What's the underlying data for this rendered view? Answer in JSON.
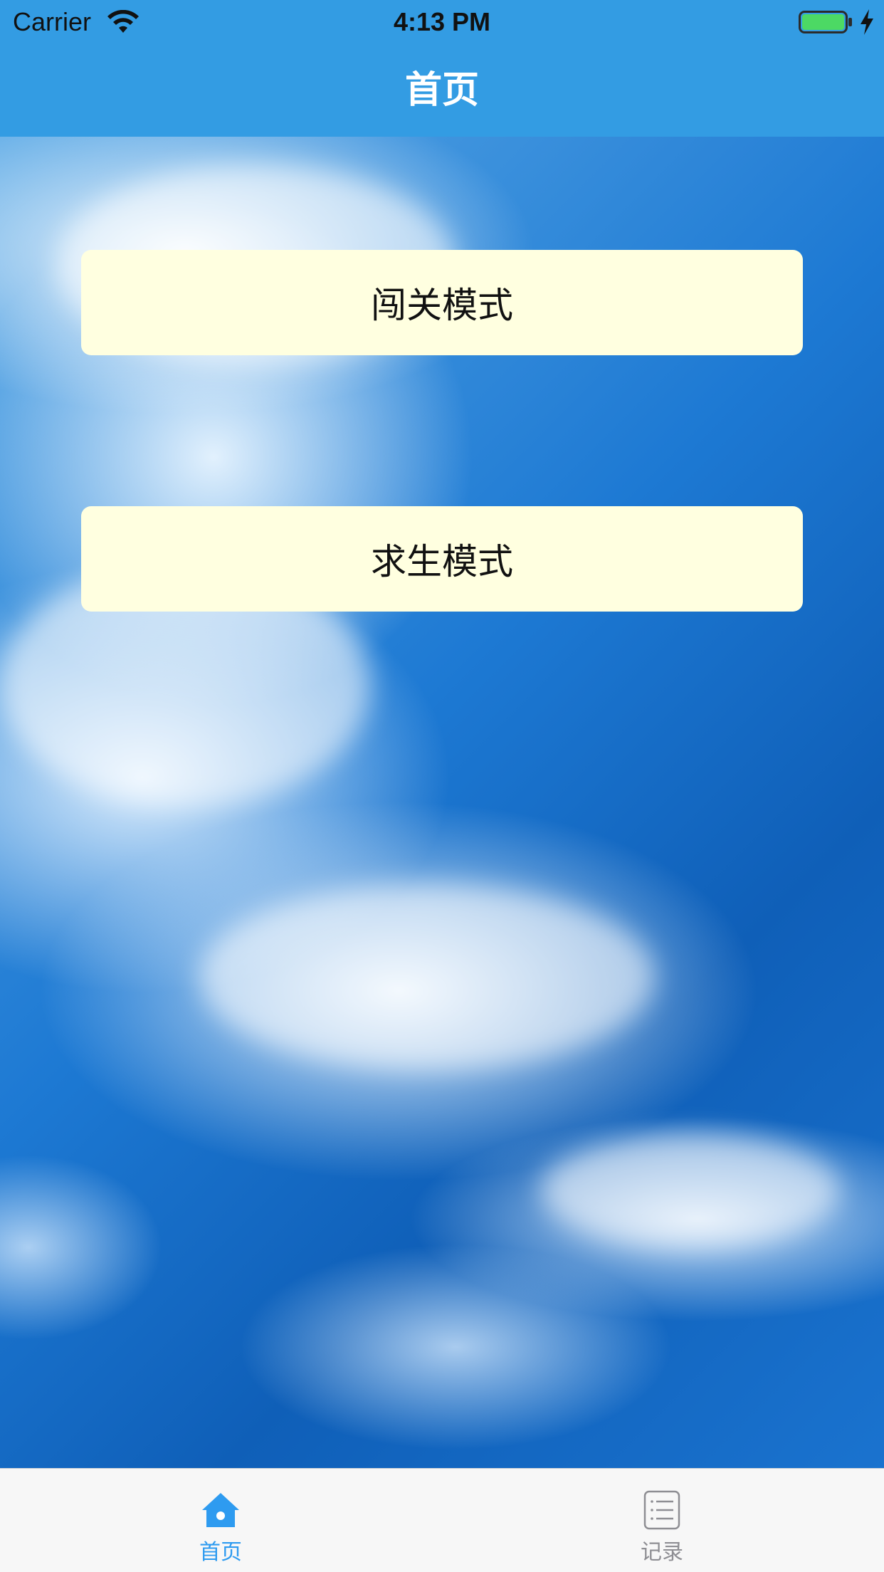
{
  "status_bar": {
    "carrier": "Carrier",
    "time": "4:13 PM",
    "wifi_icon": "wifi-icon",
    "battery_icon": "battery-full-icon",
    "charging_icon": "charging-bolt-icon",
    "battery_level": 1.0
  },
  "nav": {
    "title": "首页",
    "background_color": "#339ce3"
  },
  "main": {
    "background": "sky-with-clouds-image",
    "buttons": [
      {
        "label": "闯关模式",
        "background_color": "#ffffe0"
      },
      {
        "label": "求生模式",
        "background_color": "#ffffe0"
      }
    ]
  },
  "tab_bar": {
    "items": [
      {
        "label": "首页",
        "icon": "home-icon",
        "selected": true,
        "color": "#2e9bf0"
      },
      {
        "label": "记录",
        "icon": "list-icon",
        "selected": false,
        "color": "#8e8e93"
      }
    ]
  }
}
